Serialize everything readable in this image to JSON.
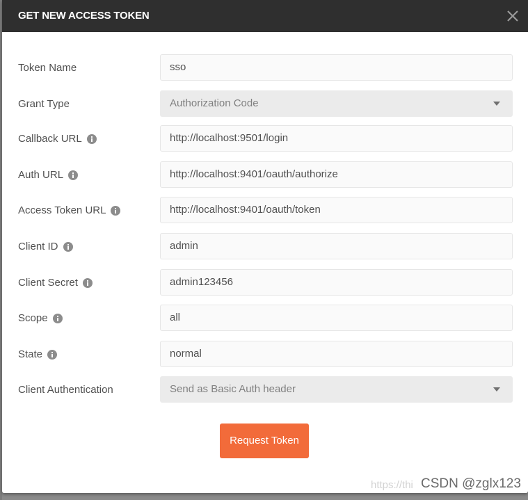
{
  "dialog": {
    "title": "GET NEW ACCESS TOKEN",
    "close_icon": "close-icon"
  },
  "fields": [
    {
      "label": "Token Name",
      "value": "sso",
      "type": "text",
      "info": false
    },
    {
      "label": "Grant Type",
      "value": "Authorization Code",
      "type": "select",
      "info": false
    },
    {
      "label": "Callback URL",
      "value": "http://localhost:9501/login",
      "type": "text",
      "info": true
    },
    {
      "label": "Auth URL",
      "value": "http://localhost:9401/oauth/authorize",
      "type": "text",
      "info": true
    },
    {
      "label": "Access Token URL",
      "value": "http://localhost:9401/oauth/token",
      "type": "text",
      "info": true
    },
    {
      "label": "Client ID",
      "value": "admin",
      "type": "text",
      "info": true
    },
    {
      "label": "Client Secret",
      "value": "admin123456",
      "type": "text",
      "info": true
    },
    {
      "label": "Scope",
      "value": "all",
      "type": "text",
      "info": true
    },
    {
      "label": "State",
      "value": "normal",
      "type": "text",
      "info": true
    },
    {
      "label": "Client Authentication",
      "value": "Send as Basic Auth header",
      "type": "select",
      "info": false
    }
  ],
  "actions": {
    "request_token_label": "Request Token"
  },
  "colors": {
    "header_bg": "#2f2f2f",
    "accent": "#f26b3a",
    "field_bg": "#fafafa",
    "select_bg": "#ebebeb"
  },
  "watermark": {
    "faint": "https://thi",
    "text": "CSDN @zglx123"
  }
}
